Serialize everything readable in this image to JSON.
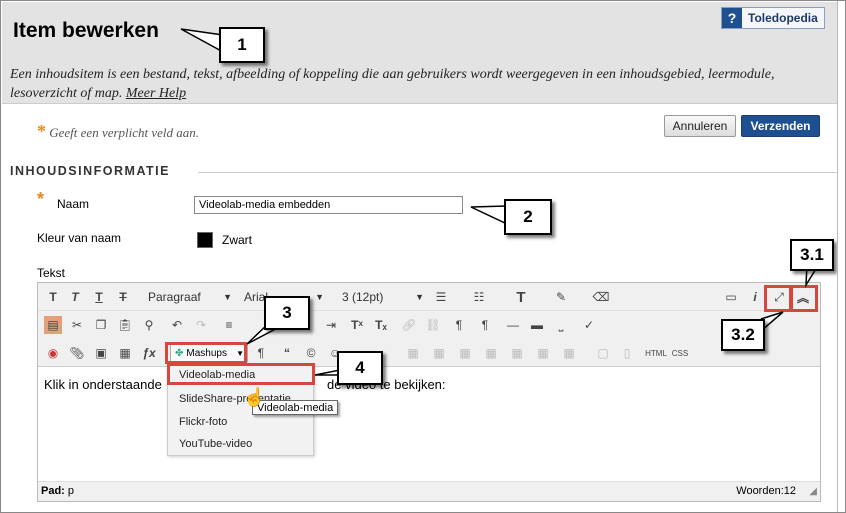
{
  "header": {
    "title": "Item bewerken",
    "description": "Een inhoudsitem is een bestand, tekst, afbeelding of koppeling die aan gebruikers wordt weergegeven in een inhoudsgebied, leermodule, lesoverzicht of map.",
    "help_link": "Meer Help",
    "toledopedia": "Toledopedia",
    "toledopedia_icon": "?"
  },
  "form": {
    "required_note": "Geeft een verplicht veld aan.",
    "cancel_label": "Annuleren",
    "submit_label": "Verzenden",
    "section_title": "INHOUDSINFORMATIE",
    "name_label": "Naam",
    "name_value": "Videolab-media embedden",
    "color_label": "Kleur van naam",
    "color_value": "Zwart",
    "text_label": "Tekst"
  },
  "editor": {
    "paragraph_select": "Paragraaf",
    "font_select": "Arial",
    "size_select": "3 (12pt)",
    "mashups_label": "Mashups",
    "content_before": "Klik in onderstaande",
    "content_after": "de video te bekijken:",
    "path_label": "Pad:",
    "path_value": "p",
    "word_count": "Woorden:12",
    "toolbar_html": "HTML",
    "toolbar_css": "CSS"
  },
  "mashups_menu": {
    "items": [
      "Videolab-media",
      "SlideShare-presentatie",
      "Flickr-foto",
      "YouTube-video"
    ],
    "tooltip": "Videolab-media"
  },
  "callouts": {
    "c1": "1",
    "c2": "2",
    "c3": "3",
    "c31": "3.1",
    "c32": "3.2",
    "c4": "4"
  },
  "colors": {
    "header_bg": "#e3e3e3",
    "submit_bg": "#1d4f91",
    "required_star": "#e8891a",
    "highlight": "#d9463e"
  }
}
